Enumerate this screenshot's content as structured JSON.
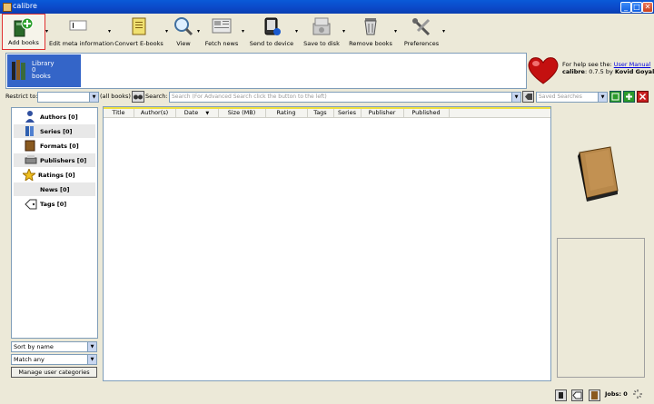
{
  "window": {
    "title": "calibre",
    "minimize": "_",
    "maximize": "□",
    "close": "✕"
  },
  "toolbar": {
    "add_books": "Add books",
    "edit_meta": "Edit meta information",
    "convert": "Convert E-books",
    "view": "View",
    "fetch_news": "Fetch news",
    "send_to_device": "Send to device",
    "save_to_disk": "Save to disk",
    "remove_books": "Remove books",
    "preferences": "Preferences",
    "dropdown": "▾"
  },
  "library": {
    "line1": "Library",
    "line2": "0",
    "line3": "books"
  },
  "help": {
    "prefix": "For help see the:",
    "link": "User Manual",
    "version_label": "calibre",
    "version": ": 0.7.5 by ",
    "author": "Kovid Goyal"
  },
  "search": {
    "restrict_label": "Restrict to:",
    "restrict_value": "",
    "all_books": "(all books)",
    "search_label": "Search:",
    "placeholder": "Search (For Advanced Search click the button to the left)",
    "saved_searches": "Saved Searches"
  },
  "tag_browser": {
    "items": [
      {
        "label": "Authors [0]"
      },
      {
        "label": "Series [0]"
      },
      {
        "label": "Formats [0]"
      },
      {
        "label": "Publishers [0]"
      },
      {
        "label": "Ratings [0]"
      },
      {
        "label": "News [0]"
      },
      {
        "label": "Tags [0]"
      }
    ],
    "sort_by": "Sort by name",
    "match": "Match any",
    "manage": "Manage user categories"
  },
  "table": {
    "columns": [
      "Title",
      "Author(s)",
      "Date",
      "Size (MB)",
      "Rating",
      "Tags",
      "Series",
      "Publisher",
      "Published"
    ],
    "sort_indicator": "▼"
  },
  "status": {
    "jobs": "Jobs: 0"
  }
}
